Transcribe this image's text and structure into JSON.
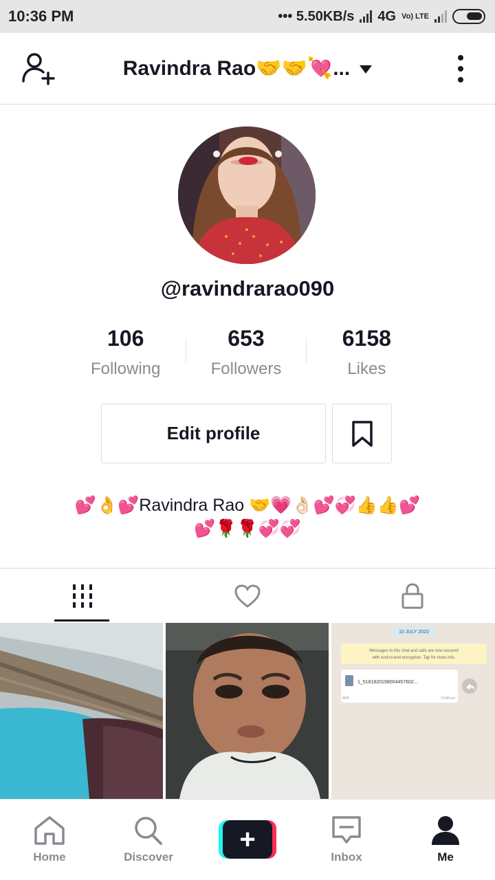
{
  "status_bar": {
    "time": "10:36 PM",
    "network_speed": "••• 5.50KB/s",
    "network_type": "4G",
    "volte_label": "Vo) LTE"
  },
  "header": {
    "title": "Ravindra Rao🤝🤝💘..."
  },
  "profile": {
    "username": "@ravindrarao090",
    "stats": [
      {
        "value": "106",
        "label": "Following"
      },
      {
        "value": "653",
        "label": "Followers"
      },
      {
        "value": "6158",
        "label": "Likes"
      }
    ],
    "edit_label": "Edit profile",
    "bio_line1": "💕👌💕Ravindra Rao 🤝💗👌🏻💕💞👍👍💕",
    "bio_line2": "💕🌹🌹💞💞"
  },
  "thumbnails": {
    "chat_date": "10 JULY 2020",
    "chat_notice": "Messages to this chat and calls are now secured with end-to-end encryption. Tap for more info.",
    "file_name": "1_5181820198004457602...",
    "file_type": "APK",
    "file_time": "10:08 am"
  },
  "bottom_nav": [
    {
      "label": "Home",
      "icon": "home-icon"
    },
    {
      "label": "Discover",
      "icon": "search-icon"
    },
    {
      "label": "",
      "icon": "plus-icon"
    },
    {
      "label": "Inbox",
      "icon": "inbox-icon"
    },
    {
      "label": "Me",
      "icon": "person-icon"
    }
  ],
  "colors": {
    "text_primary": "#161823",
    "text_secondary": "#8a8b91",
    "accent_cyan": "#25f4ee",
    "accent_red": "#fe2c55"
  }
}
